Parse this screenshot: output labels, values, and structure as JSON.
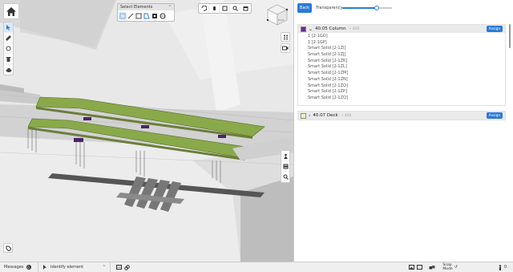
{
  "select_panel": {
    "title": "Select Elements",
    "tools": [
      "pointer-select-icon",
      "line-select-icon",
      "rect-select-icon",
      "polygon-select-icon",
      "isolate-icon",
      "globe-icon"
    ]
  },
  "view_tools": [
    "undo-icon",
    "pan-hand-icon",
    "fit-view-icon",
    "zoom-icon",
    "screenshot-icon"
  ],
  "cube": {
    "face": "Front"
  },
  "panel": {
    "back_label": "Back",
    "transparency_label": "Transparency",
    "transparency_value": 0.7,
    "groups": [
      {
        "title": "40.05 Column",
        "count": "• 400",
        "color": "#6a2a8e",
        "expanded": true,
        "assign_label": "Assign",
        "items": [
          "1 [2-1GO]",
          "1 [2-1GP]",
          "Smart Solid [2-1ZI]",
          "Smart Solid [2-1ZJ]",
          "Smart Solid [2-1ZK]",
          "Smart Solid [2-1ZL]",
          "Smart Solid [2-1ZM]",
          "Smart Solid [2-1ZN]",
          "Smart Solid [2-1ZO]",
          "Smart Solid [2-1ZP]",
          "Smart Solid [2-1ZQ]"
        ]
      },
      {
        "title": "40.07 Deck",
        "count": "• 400",
        "color": "#eef5b8",
        "expanded": false,
        "assign_label": "Assign",
        "items": []
      }
    ]
  },
  "status": {
    "messages_label": "Messages",
    "messages_count": "0",
    "identify_label": "Identify element",
    "snap_label": "Snap\nMode",
    "right_count": "0"
  },
  "colors": {
    "accent": "#2b7bd6",
    "deck": "#8aa94a",
    "column": "#6a2a8e"
  }
}
